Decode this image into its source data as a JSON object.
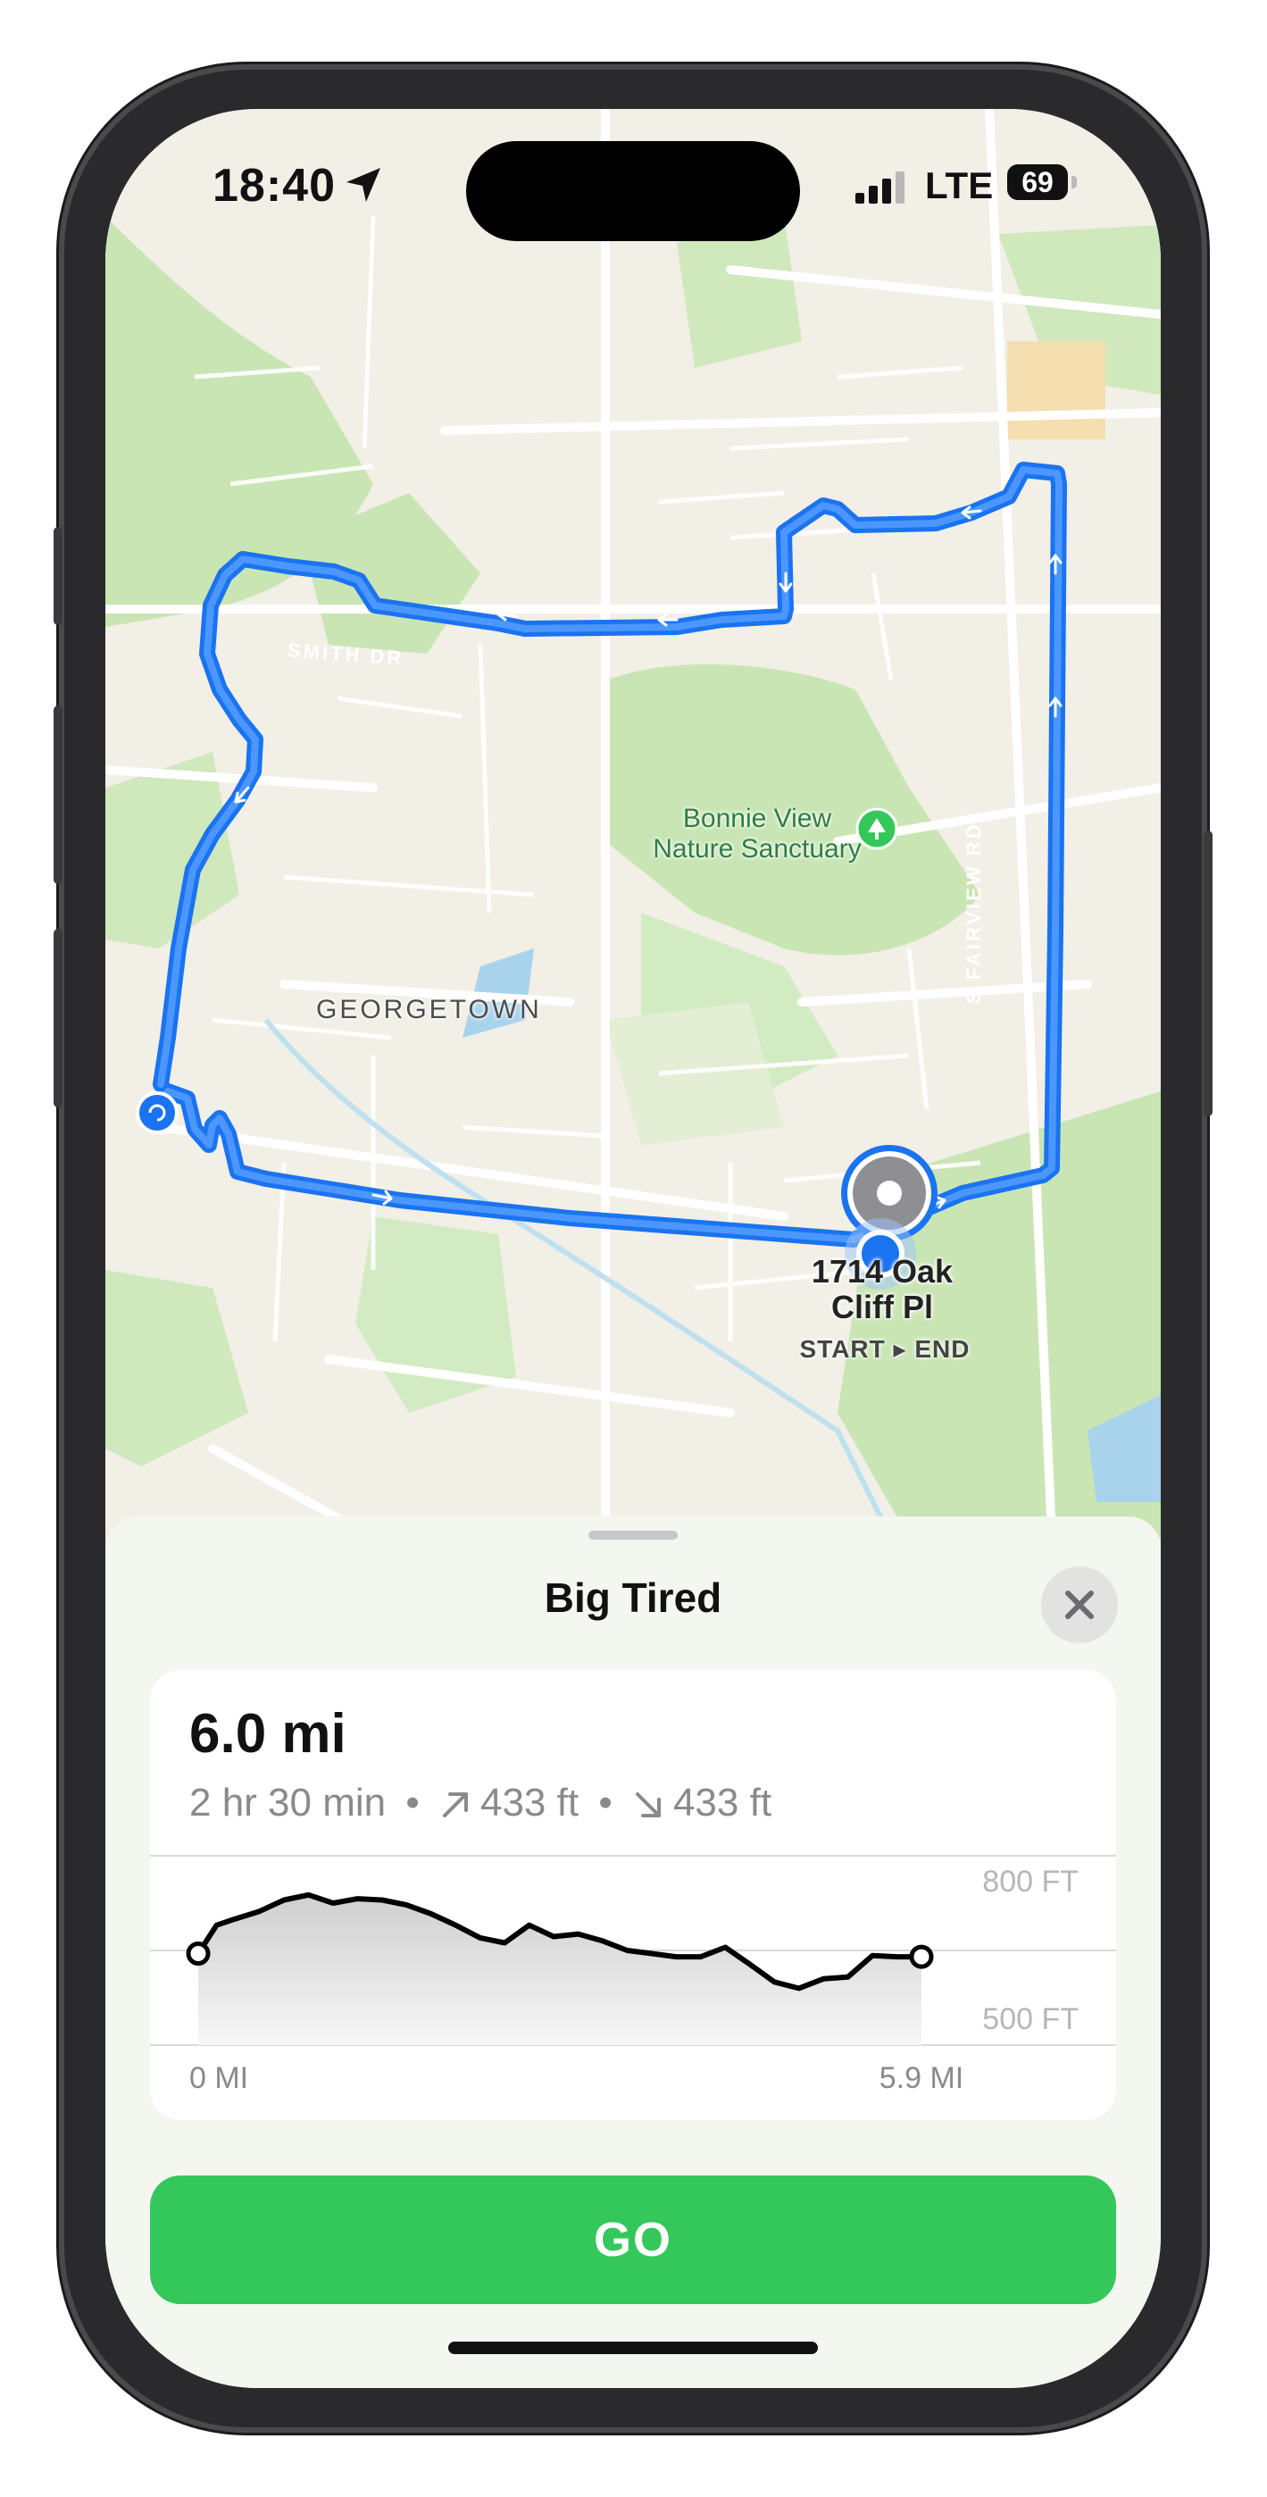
{
  "status_bar": {
    "time": "18:40",
    "location_icon": "location-arrow-icon",
    "signal_icon": "cellular-signal-icon",
    "network": "LTE",
    "battery": "69"
  },
  "map": {
    "street_labels": [
      "SMITH DR",
      "S FAIRVIEW RD"
    ],
    "park_name_line1": "Bonnie View",
    "park_name_line2": "Nature Sanctuary",
    "neighborhood": "GEORGETOWN",
    "pin_address_line1": "1714 Oak",
    "pin_address_line2": "Cliff Pl",
    "pin_subtitle": "START ▸ END",
    "colors": {
      "route": "#1a73f0",
      "park": "#c9e5b4",
      "land": "#f1efe6",
      "road": "#ffffff"
    }
  },
  "sheet": {
    "title": "Big Tired",
    "close_icon": "close-x-icon",
    "distance": "6.0 mi",
    "duration": "2 hr 30 min",
    "separator": "•",
    "ascent": "433 ft",
    "descent": "433 ft",
    "ascent_icon": "arrow-up-right-icon",
    "descent_icon": "arrow-down-right-icon",
    "go_label": "GO"
  },
  "chart_data": {
    "type": "area",
    "title": "",
    "x_start_label": "0 MI",
    "x_end_label": "5.9 MI",
    "y_labels": [
      "800 FT",
      "500 FT"
    ],
    "xlim": [
      0,
      5.9
    ],
    "ylim": [
      500,
      800
    ],
    "x": [
      0,
      0.15,
      0.3,
      0.5,
      0.7,
      0.9,
      1.1,
      1.3,
      1.5,
      1.7,
      1.9,
      2.1,
      2.3,
      2.5,
      2.7,
      2.9,
      3.1,
      3.3,
      3.5,
      3.7,
      3.9,
      4.1,
      4.3,
      4.5,
      4.7,
      4.9,
      5.1,
      5.3,
      5.5,
      5.7,
      5.9
    ],
    "y": [
      645,
      690,
      700,
      712,
      730,
      738,
      725,
      732,
      730,
      722,
      708,
      690,
      670,
      662,
      690,
      672,
      676,
      665,
      650,
      645,
      640,
      640,
      655,
      628,
      600,
      590,
      605,
      608,
      642,
      640,
      640
    ],
    "grid": true,
    "color": "#000000"
  }
}
